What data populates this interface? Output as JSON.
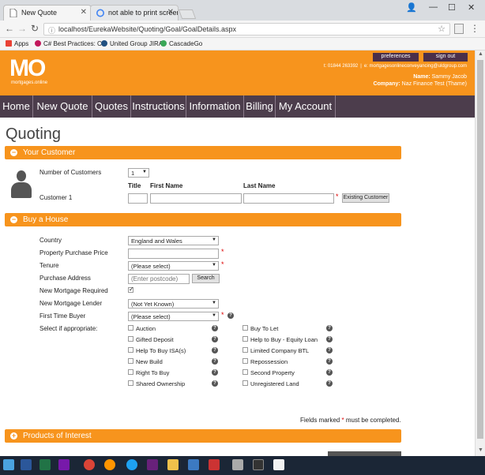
{
  "browser": {
    "tabs": [
      {
        "label": "New Quote"
      },
      {
        "label": "not able to print screen"
      }
    ],
    "url": "localhost/EurekaWebsite/Quoting/Goal/GoalDetails.aspx",
    "bookmarks": [
      {
        "label": "Apps"
      },
      {
        "label": "C# Best Practices: Co"
      },
      {
        "label": "United Group JIRA"
      },
      {
        "label": "CascadeGo"
      }
    ]
  },
  "site": {
    "logo": "MO",
    "logo_sub": "mortgages.online",
    "header_buttons": [
      "preferences",
      "sign out"
    ],
    "phone": "t: 01844 263392",
    "email": "e: mortgagesonlineconveyancing@uldgroup.com",
    "name_label": "Name:",
    "name_value": "Sammy Jacob",
    "company_label": "Company:",
    "company_value": "Naz Finance Test (Thame)"
  },
  "nav": [
    "Home",
    "New Quote",
    "Quotes",
    "Instructions",
    "Information",
    "Billing",
    "My Account"
  ],
  "page_title": "Quoting",
  "your_customer": {
    "title": "Your Customer",
    "num_customers_label": "Number of Customers",
    "num_customers_value": "1",
    "col_title": "Title",
    "col_first": "First Name",
    "col_last": "Last Name",
    "customer_label": "Customer 1",
    "existing_button": "Existing Customer"
  },
  "buy_house": {
    "title": "Buy a House",
    "country_label": "Country",
    "country_value": "England and Wales",
    "price_label": "Property Purchase Price",
    "tenure_label": "Tenure",
    "tenure_value": "(Please select)",
    "address_label": "Purchase Address",
    "address_placeholder": "(Enter postcode)",
    "search_button": "Search",
    "new_mortgage_label": "New Mortgage Required",
    "lender_label": "New Mortgage Lender",
    "lender_value": "(Not Yet Known)",
    "ftb_label": "First Time Buyer",
    "ftb_value": "(Please select)",
    "select_label": "Select if appropriate:",
    "options_left": [
      "Auction",
      "Gifted Deposit",
      "Help To Buy ISA(s)",
      "New Build",
      "Right To Buy",
      "Shared Ownership"
    ],
    "options_right": [
      "Buy To Let",
      "Help to Buy - Equity Loan",
      "Limited Company BTL",
      "Repossession",
      "Second Property",
      "Unregistered Land"
    ]
  },
  "footer_note_pre": "Fields marked",
  "footer_note_post": "must be completed.",
  "products": {
    "title": "Products of Interest"
  }
}
